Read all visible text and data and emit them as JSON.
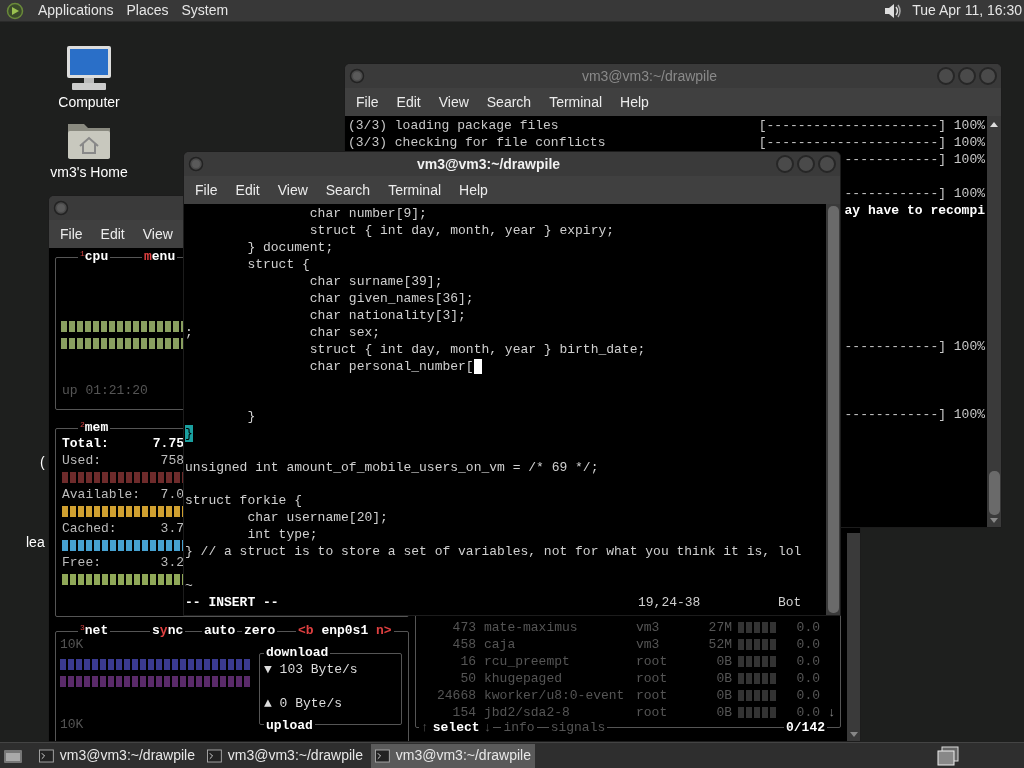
{
  "top_panel": {
    "menus": [
      "Applications",
      "Places",
      "System"
    ],
    "clock": "Tue Apr 11, 16:30"
  },
  "desktop_icons": [
    {
      "kind": "computer",
      "label": "Computer"
    },
    {
      "kind": "folder",
      "label": "vm3's Home"
    }
  ],
  "desktop_fragments": [
    "(",
    "lea"
  ],
  "back_terminal": {
    "title": "vm3@vm3:~/drawpile",
    "active": false,
    "menus": [
      "File",
      "Edit",
      "View",
      "Search",
      "Terminal",
      "Help"
    ],
    "lines": [
      {
        "kind": "text",
        "left": "(3/3) loading package files",
        "right": "[----------------------] 100%"
      },
      {
        "kind": "text",
        "left": "(3/3) checking for file conflicts",
        "right": "[----------------------] 100%"
      },
      {
        "kind": "text",
        "right": "------------] 100%"
      },
      {
        "kind": "blank"
      },
      {
        "kind": "text",
        "right": "------------] 100%"
      },
      {
        "kind": "text",
        "right": "ay have to recompi",
        "bold": true
      },
      {
        "kind": "blank"
      },
      {
        "kind": "blank"
      },
      {
        "kind": "blank"
      },
      {
        "kind": "blank"
      },
      {
        "kind": "blank"
      },
      {
        "kind": "blank"
      },
      {
        "kind": "blank"
      },
      {
        "kind": "text",
        "right": "------------] 100%"
      },
      {
        "kind": "blank"
      },
      {
        "kind": "blank"
      },
      {
        "kind": "blank"
      },
      {
        "kind": "text",
        "right": "------------] 100%"
      }
    ]
  },
  "front_terminal": {
    "title": "vm3@vm3:~/drawpile",
    "active": true,
    "menus": [
      "File",
      "Edit",
      "View",
      "Search",
      "Terminal",
      "Help"
    ],
    "lines": [
      {
        "text": "                char number[9];"
      },
      {
        "text": "                struct { int day, month, year } expiry;"
      },
      {
        "text": "        } document;"
      },
      {
        "text": "        struct {"
      },
      {
        "text": "                char surname[39];"
      },
      {
        "text": "                char given_names[36];"
      },
      {
        "text": "                char nationality[3];"
      },
      {
        "text": ";               char sex;"
      },
      {
        "text": "                struct { int day, month, year } birth_date;"
      },
      {
        "text": "                char personal_number[",
        "cursor": true
      },
      {
        "kind": "blank"
      },
      {
        "kind": "blank"
      },
      {
        "text": "        }"
      },
      {
        "text": "}",
        "match": true
      },
      {
        "kind": "blank"
      },
      {
        "text": "unsigned int amount_of_mobile_users_on_vm = /* 69 */;"
      },
      {
        "kind": "blank"
      },
      {
        "text": "struct forkie {"
      },
      {
        "text": "        char username[20];"
      },
      {
        "text": "        int type;"
      },
      {
        "text": "} // a struct is to store a set of variables, not for what you think it is, lol"
      },
      {
        "kind": "blank"
      },
      {
        "text": "~"
      }
    ],
    "status": {
      "mode": "-- INSERT --",
      "position": "19,24-38",
      "scroll": "Bot"
    }
  },
  "monitor": {
    "menus": [
      "File",
      "Edit",
      "View"
    ],
    "cpu": {
      "number": "1",
      "title": "cpu",
      "menu": {
        "key": "m",
        "after": "enu"
      },
      "uptime": "up 01:21:20"
    },
    "mem": {
      "number": "2",
      "title": "mem",
      "rows": [
        {
          "label": "Total:",
          "value": "7.75",
          "bold": true
        },
        {
          "label": "Used:",
          "value": "758",
          "color": "#6e2b2b"
        },
        {
          "label": "Available:",
          "value": "7.0",
          "color": "#d0a030"
        },
        {
          "label": "Cached:",
          "value": "3.7",
          "color": "#46a0d0"
        },
        {
          "label": "Free:",
          "value": "3.2",
          "color": "#90a858"
        }
      ]
    },
    "net": {
      "number": "3",
      "title": "net",
      "tabs": [
        {
          "before": "s",
          "key": "y",
          "after": "nc"
        },
        {
          "after": "auto"
        },
        {
          "after": "zero"
        },
        {
          "key": "<b",
          "after": " enp0s1 ",
          "after_key": "n>"
        }
      ],
      "scale_top": "10K",
      "scale_bottom": "10K",
      "download_label": "download",
      "download": "▼ 103 Byte/s",
      "upload": "▲ 0 Byte/s",
      "upload_label": "upload"
    },
    "proc": {
      "rows": [
        {
          "pid": "473",
          "name": "mate-maximus",
          "user": "vm3",
          "mem": "27M",
          "cpu": "0.0"
        },
        {
          "pid": "458",
          "name": "caja",
          "user": "vm3",
          "mem": "52M",
          "cpu": "0.0"
        },
        {
          "pid": "16",
          "name": "rcu_preempt",
          "user": "root",
          "mem": "0B",
          "cpu": "0.0"
        },
        {
          "pid": "50",
          "name": "khugepaged",
          "user": "root",
          "mem": "0B",
          "cpu": "0.0"
        },
        {
          "pid": "24668",
          "name": "kworker/u8:0-event",
          "user": "root",
          "mem": "0B",
          "cpu": "0.0"
        },
        {
          "pid": "154",
          "name": "jbd2/sda2-8",
          "user": "root",
          "mem": "0B",
          "cpu": "0.0"
        }
      ],
      "scroll_mark": "↓",
      "footer": {
        "up": "↑",
        "select": "select",
        "down": "↓",
        "info": "info",
        "signals": "signals",
        "count": "0/142"
      }
    }
  },
  "taskbar": {
    "tasks": [
      {
        "label": "vm3@vm3:~/drawpile",
        "selected": false
      },
      {
        "label": "vm3@vm3:~/drawpile",
        "selected": false
      },
      {
        "label": "vm3@vm3:~/drawpile",
        "selected": true
      }
    ]
  }
}
